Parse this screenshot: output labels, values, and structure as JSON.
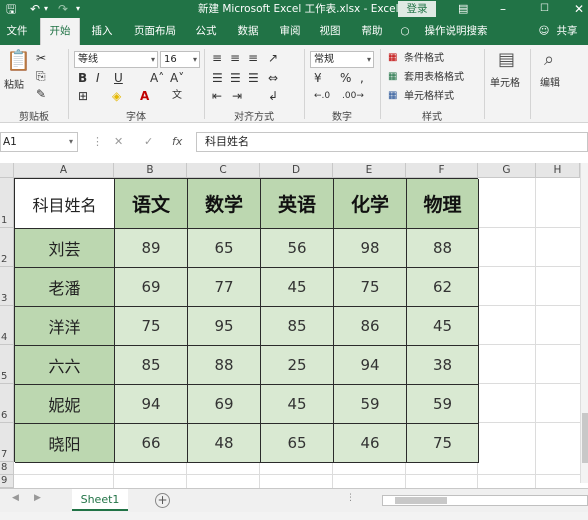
{
  "window": {
    "title": "新建 Microsoft Excel 工作表.xlsx  -  Excel",
    "login": "登录"
  },
  "tabs": [
    "文件",
    "开始",
    "插入",
    "页面布局",
    "公式",
    "数据",
    "审阅",
    "视图",
    "帮助"
  ],
  "tell_me": "操作说明搜索",
  "share": "共享",
  "ribbon": {
    "paste": "粘贴",
    "clipboard": "剪贴板",
    "font_name": "等线",
    "font_size": "16",
    "font_group": "字体",
    "align_group": "对齐方式",
    "number_format": "常规",
    "number_group": "数字",
    "cond_format": "条件格式",
    "table_format": "套用表格格式",
    "cell_style": "单元格样式",
    "style_group": "样式",
    "cells": "单元格",
    "editing": "编辑"
  },
  "formula_bar": {
    "cell_ref": "A1",
    "content": "科目姓名"
  },
  "columns": [
    "A",
    "B",
    "C",
    "D",
    "E",
    "F",
    "G",
    "H"
  ],
  "rows": [
    "1",
    "2",
    "3",
    "4",
    "5",
    "6",
    "7",
    "8",
    "9"
  ],
  "table": {
    "headers": [
      "科目姓名",
      "语文",
      "数学",
      "英语",
      "化学",
      "物理"
    ],
    "rows": [
      [
        "刘芸",
        "89",
        "65",
        "56",
        "98",
        "88"
      ],
      [
        "老潘",
        "69",
        "77",
        "45",
        "75",
        "62"
      ],
      [
        "洋洋",
        "75",
        "95",
        "85",
        "86",
        "45"
      ],
      [
        "六六",
        "85",
        "88",
        "25",
        "94",
        "38"
      ],
      [
        "妮妮",
        "94",
        "69",
        "45",
        "59",
        "59"
      ],
      [
        "晓阳",
        "66",
        "48",
        "65",
        "46",
        "75"
      ]
    ]
  },
  "sheets": [
    "Sheet1"
  ],
  "colors": {
    "excel_green": "#217346",
    "header_fill": "#bcd7b0",
    "value_fill": "#d9e9d2"
  }
}
